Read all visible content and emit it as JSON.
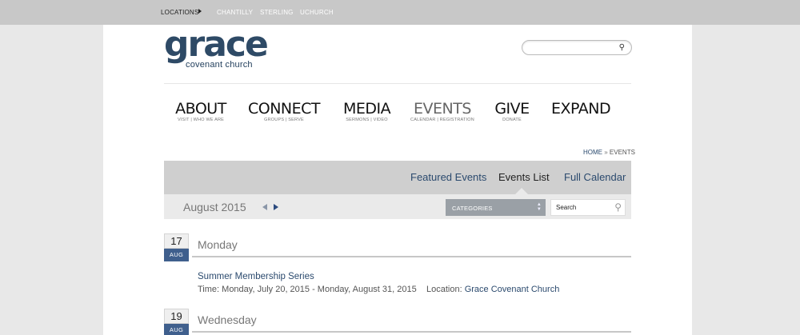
{
  "topbar": {
    "label": "LOCATIONS",
    "links": [
      "CHANTILLY",
      "STERLING",
      "UCHURCH"
    ]
  },
  "logo": {
    "word": "grace",
    "tagline": "covenant church"
  },
  "search_top": {
    "icon": "search-icon",
    "placeholder": ""
  },
  "nav": [
    {
      "title": "ABOUT",
      "sub": "VISIT | WHO WE ARE",
      "active": false
    },
    {
      "title": "CONNECT",
      "sub": "GROUPS | SERVE",
      "active": false
    },
    {
      "title": "MEDIA",
      "sub": "SERMONS | VIDEO",
      "active": false
    },
    {
      "title": "EVENTS",
      "sub": "CALENDAR | REGISTRATION",
      "active": true
    },
    {
      "title": "GIVE",
      "sub": "DONATE",
      "active": false
    },
    {
      "title": "EXPAND",
      "sub": "",
      "active": false
    }
  ],
  "breadcrumb": {
    "home": "HOME",
    "sep": "»",
    "current": "EVENTS"
  },
  "tabs": [
    {
      "label": "Featured Events",
      "active": false
    },
    {
      "label": "Events List",
      "active": true
    },
    {
      "label": "Full Calendar",
      "active": false
    }
  ],
  "filter": {
    "month": "August 2015",
    "categories_label": "CATEGORIES",
    "search_placeholder": "Search"
  },
  "days": [
    {
      "day": "17",
      "month": "AUG",
      "weekday": "Monday",
      "events": [
        {
          "title": "Summer Membership Series",
          "time_label": "Time:",
          "time": "Monday, July 20, 2015 - Monday, August 31, 2015",
          "location_label": "Location:",
          "location": "Grace Covenant Church"
        }
      ]
    },
    {
      "day": "19",
      "month": "AUG",
      "weekday": "Wednesday",
      "events": []
    }
  ],
  "colors": {
    "accent": "#2b4a6e",
    "badge_month": "#3f5f8d",
    "topbar": "#c8c8c8",
    "tab_band": "#cfcfcf"
  }
}
